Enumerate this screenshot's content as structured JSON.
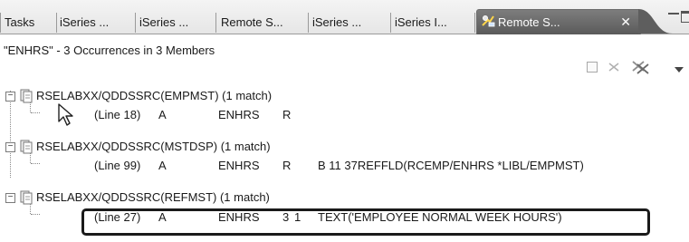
{
  "tabs": [
    {
      "label": "Tasks"
    },
    {
      "label": "iSeries ..."
    },
    {
      "label": "iSeries ..."
    },
    {
      "label": "Remote S..."
    },
    {
      "label": "iSeries ..."
    },
    {
      "label": "iSeries I..."
    },
    {
      "label": "Remote S...",
      "active": true
    }
  ],
  "header": {
    "title": "\"ENHRS\" - 3 Occurrences in 3 Members"
  },
  "results": [
    {
      "member": "RSELABXX/QDDSSRC(EMPMST) (1 match)",
      "match": {
        "line": "(Line 18)",
        "type": "A",
        "field": "ENHRS",
        "c1": "R",
        "c2": "",
        "rest": ""
      }
    },
    {
      "member": "RSELABXX/QDDSSRC(MSTDSP) (1 match)",
      "match": {
        "line": "(Line 99)",
        "type": "A",
        "field": "ENHRS",
        "c1": "R",
        "c2": "",
        "rest": "B 11 37REFFLD(RCEMP/ENHRS *LIBL/EMPMST)"
      }
    },
    {
      "member": "RSELABXX/QDDSSRC(REFMST) (1 match)",
      "match": {
        "line": "(Line 27)",
        "type": "A",
        "field": "ENHRS",
        "c1": "3",
        "c2": "1",
        "rest": "TEXT('EMPLOYEE NORMAL WEEK HOURS')"
      }
    }
  ],
  "colors": {
    "active_tab": "#6b6b6b",
    "highlight_border": "#1a1a1a"
  }
}
